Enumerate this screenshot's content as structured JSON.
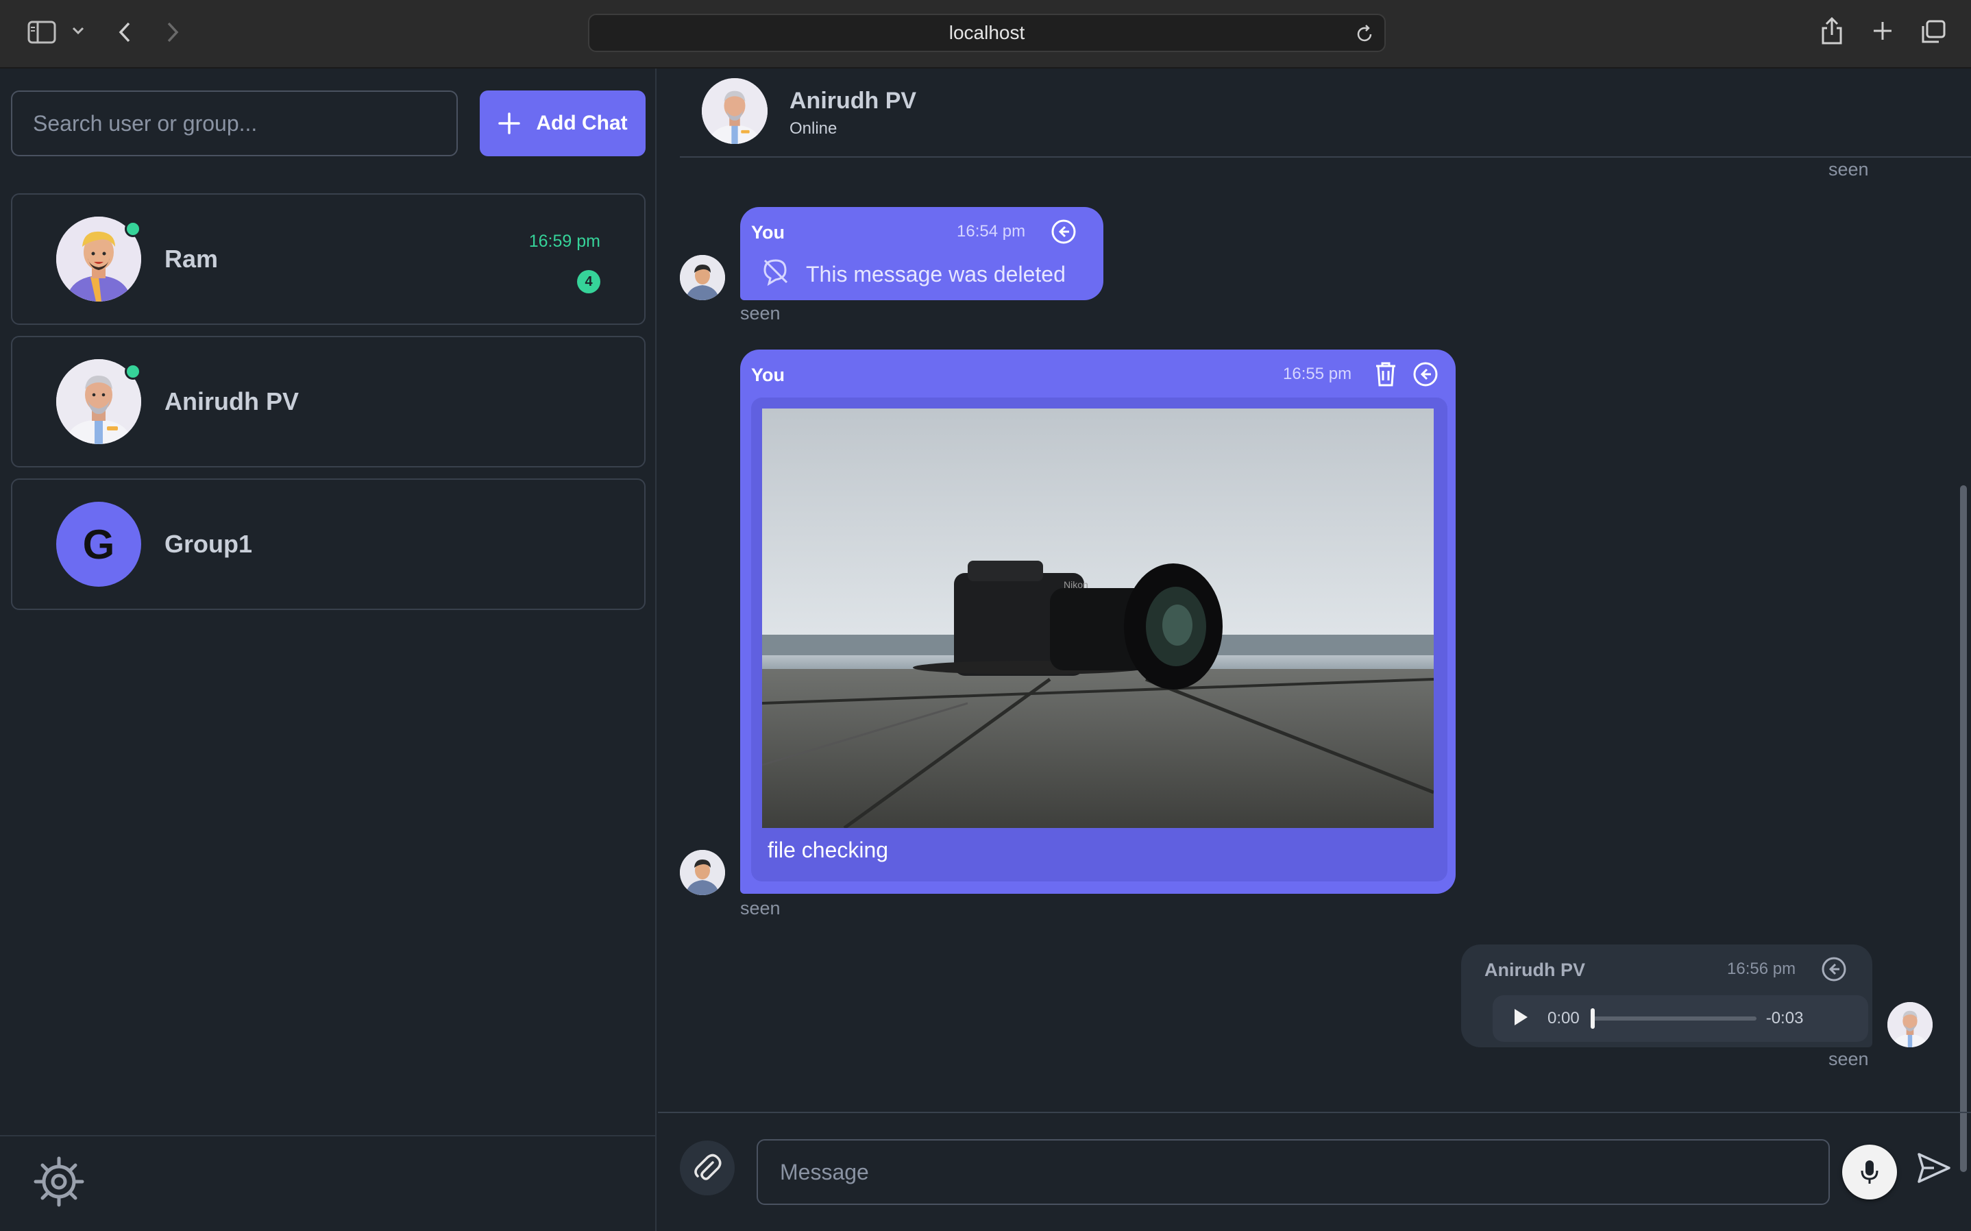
{
  "browser": {
    "url": "localhost"
  },
  "sidebar": {
    "search_placeholder": "Search user or group...",
    "add_chat_label": "Add Chat",
    "chats": [
      {
        "name": "Ram",
        "time": "16:59 pm",
        "unread": "4",
        "online": true
      },
      {
        "name": "Anirudh PV",
        "online": true
      },
      {
        "name": "Group1",
        "initial": "G"
      }
    ]
  },
  "chat": {
    "header": {
      "name": "Anirudh PV",
      "status": "Online"
    },
    "top_seen": "seen",
    "messages": [
      {
        "sender": "You",
        "time": "16:54 pm",
        "text": "This message was deleted",
        "status": "seen"
      },
      {
        "sender": "You",
        "time": "16:55 pm",
        "caption": "file checking",
        "status": "seen"
      },
      {
        "sender": "Anirudh PV",
        "time": "16:56 pm",
        "audio_current": "0:00",
        "audio_remaining": "-0:03",
        "status": "seen"
      }
    ],
    "composer_placeholder": "Message"
  },
  "colors": {
    "primary": "#6c6cf2",
    "online": "#36d399",
    "bg": "#1d232a"
  }
}
